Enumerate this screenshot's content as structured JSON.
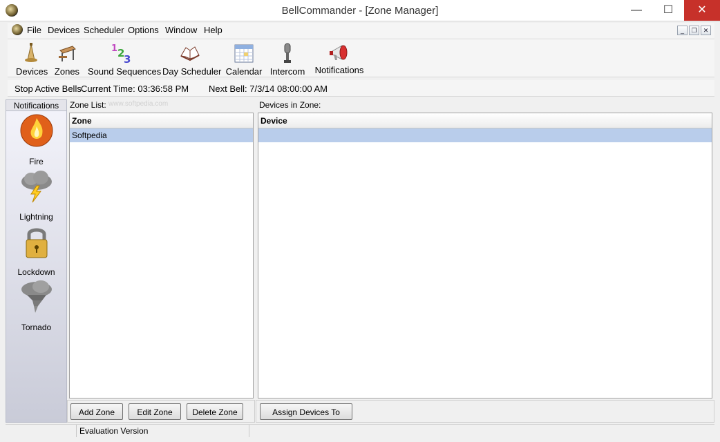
{
  "window": {
    "title": "BellCommander - [Zone Manager]",
    "min_glyph": "—",
    "max_glyph": "☐",
    "close_glyph": "✕"
  },
  "menu": {
    "items": [
      "File",
      "Devices",
      "Scheduler",
      "Options",
      "Window",
      "Help"
    ],
    "mdi_min": "_",
    "mdi_restore": "❐",
    "mdi_close": "✕"
  },
  "toolbar": {
    "items": [
      {
        "label": "Devices",
        "icon": "bell-icon"
      },
      {
        "label": "Zones",
        "icon": "school-desk-icon"
      },
      {
        "label": "Sound Sequences",
        "icon": "numbers-123-icon"
      },
      {
        "label": "Day Scheduler",
        "icon": "open-book-icon"
      },
      {
        "label": "Calendar",
        "icon": "calendar-icon"
      },
      {
        "label": "Intercom",
        "icon": "microphone-icon"
      },
      {
        "label": "Notifications",
        "icon": "megaphone-icon"
      }
    ]
  },
  "status": {
    "stop_bells": "Stop Active Bells",
    "current_time": "Current Time: 03:36:58 PM",
    "next_bell": "Next Bell: 7/3/14 08:00:00 AM"
  },
  "sidebar": {
    "header": "Notifications",
    "items": [
      {
        "label": "Fire",
        "icon": "fire-icon"
      },
      {
        "label": "Lightning",
        "icon": "lightning-cloud-icon"
      },
      {
        "label": "Lockdown",
        "icon": "padlock-icon"
      },
      {
        "label": "Tornado",
        "icon": "tornado-icon"
      }
    ]
  },
  "zone_list": {
    "label": "Zone List:",
    "column": "Zone",
    "rows": [
      "Softpedia"
    ]
  },
  "devices_in_zone": {
    "label": "Devices in Zone:",
    "column": "Device"
  },
  "buttons": {
    "add_zone": "Add Zone",
    "edit_zone": "Edit Zone",
    "delete_zone": "Delete Zone",
    "assign_devices": "Assign Devices To Zone"
  },
  "footer": {
    "text": "Evaluation Version"
  },
  "watermark": "www.softpedia.com"
}
